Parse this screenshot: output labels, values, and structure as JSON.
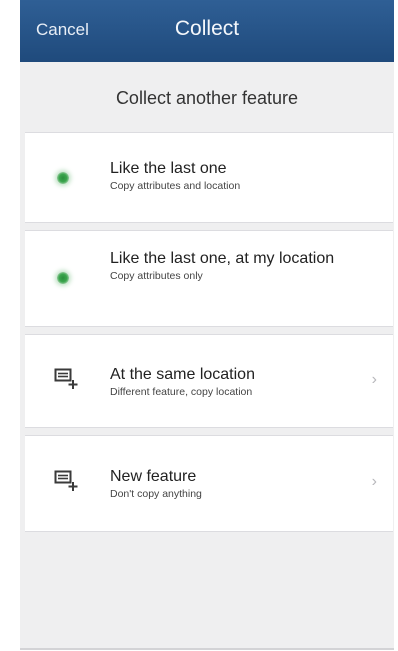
{
  "navbar": {
    "cancel_label": "Cancel",
    "title": "Collect"
  },
  "section_title": "Collect another feature",
  "options": [
    {
      "title": "Like the last one",
      "subtitle": "Copy attributes and location",
      "icon": "green-dot-icon"
    },
    {
      "title": "Like the last one, at my location",
      "subtitle": "Copy attributes only",
      "icon": "green-dot-icon"
    },
    {
      "title": "At the same location",
      "subtitle": "Different feature, copy location",
      "icon": "add-feature-icon",
      "chevron": "›"
    },
    {
      "title": "New feature",
      "subtitle": "Don't copy anything",
      "icon": "add-feature-icon",
      "chevron": "›"
    }
  ],
  "colors": {
    "navbar": "#2a5789",
    "background": "#efeff0",
    "dot": "#3ba54d"
  }
}
